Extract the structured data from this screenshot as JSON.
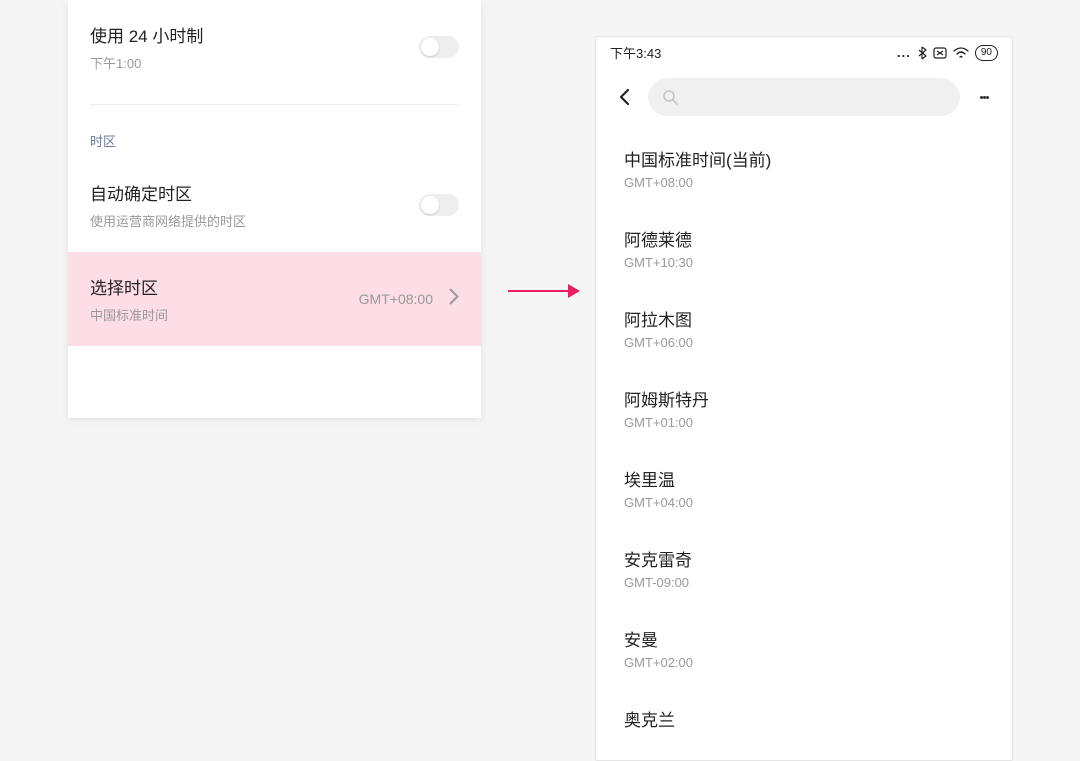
{
  "left_panel": {
    "row_24h": {
      "title": "使用 24 小时制",
      "subtitle": "下午1:00"
    },
    "section_header": "时区",
    "row_autotz": {
      "title": "自动确定时区",
      "subtitle": "使用运营商网络提供的时区"
    },
    "row_selecttz": {
      "title": "选择时区",
      "subtitle": "中国标准时间",
      "value": "GMT+08:00"
    }
  },
  "right_panel": {
    "status": {
      "time": "下午3:43",
      "battery": "90"
    },
    "timezones": [
      {
        "name": "中国标准时间(当前)",
        "offset": "GMT+08:00"
      },
      {
        "name": "阿德莱德",
        "offset": "GMT+10:30"
      },
      {
        "name": "阿拉木图",
        "offset": "GMT+06:00"
      },
      {
        "name": "阿姆斯特丹",
        "offset": "GMT+01:00"
      },
      {
        "name": "埃里温",
        "offset": "GMT+04:00"
      },
      {
        "name": "安克雷奇",
        "offset": "GMT-09:00"
      },
      {
        "name": "安曼",
        "offset": "GMT+02:00"
      },
      {
        "name": "奥克兰",
        "offset": ""
      }
    ]
  }
}
